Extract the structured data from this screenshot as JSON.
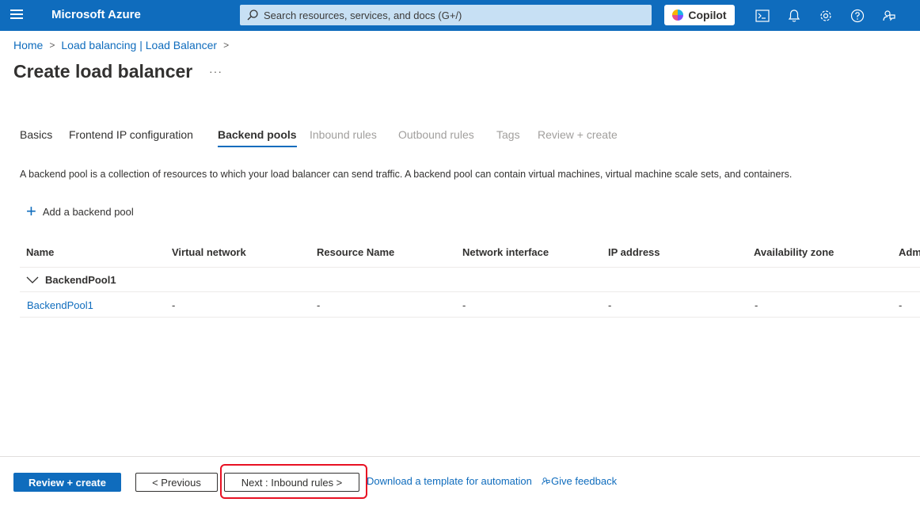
{
  "header": {
    "brand": "Microsoft Azure",
    "search_placeholder": "Search resources, services, and docs (G+/)",
    "copilot_label": "Copilot"
  },
  "icons": {
    "menu": "hamburger-icon",
    "search": "search-icon",
    "cloud_shell": "cloud-shell-icon",
    "notifications": "bell-icon",
    "settings": "gear-icon",
    "help": "help-icon",
    "feedback": "feedback-icon"
  },
  "breadcrumb": {
    "items": [
      "Home",
      "Load balancing | Load Balancer"
    ],
    "separator": ">"
  },
  "page": {
    "title": "Create load balancer",
    "more": "···"
  },
  "tabs": [
    {
      "label": "Basics",
      "state": "enabled"
    },
    {
      "label": "Frontend IP configuration",
      "state": "enabled"
    },
    {
      "label": "Backend pools",
      "state": "active"
    },
    {
      "label": "Inbound rules",
      "state": "disabled"
    },
    {
      "label": "Outbound rules",
      "state": "disabled"
    },
    {
      "label": "Tags",
      "state": "disabled"
    },
    {
      "label": "Review + create",
      "state": "disabled"
    }
  ],
  "description": "A backend pool is a collection of resources to which your load balancer can send traffic. A backend pool can contain virtual machines, virtual machine scale sets, and containers.",
  "add_backend_pool": {
    "plus": "+",
    "label": "Add a backend pool"
  },
  "table": {
    "columns": [
      "Name",
      "Virtual network",
      "Resource Name",
      "Network interface",
      "IP address",
      "Availability zone",
      "Admin"
    ],
    "groups": [
      {
        "name": "BackendPool1",
        "rows": [
          [
            "BackendPool1",
            "-",
            "-",
            "-",
            "-",
            "-",
            "-"
          ]
        ]
      }
    ]
  },
  "footer": {
    "review_create": "Review + create",
    "previous": "< Previous",
    "next": "Next : Inbound rules >",
    "download_template": "Download a template for automation",
    "give_feedback": "Give feedback"
  },
  "colors": {
    "accent": "#0f6cbd",
    "highlight": "#e81123",
    "disabled_text": "#a19f9d"
  }
}
